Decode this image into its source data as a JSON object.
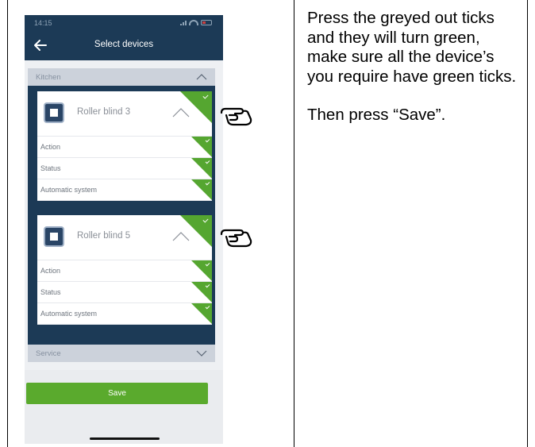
{
  "phone": {
    "status_time": "14:15",
    "nav_title": "Select devices",
    "groups": [
      {
        "label": "Kitchen",
        "expanded": true
      },
      {
        "label": "Service",
        "expanded": false
      }
    ],
    "devices": [
      {
        "name": "Roller blind 3",
        "selected": true,
        "rows": [
          {
            "label": "Action",
            "checked": true
          },
          {
            "label": "Status",
            "checked": true
          },
          {
            "label": "Automatic system",
            "checked": true
          }
        ]
      },
      {
        "name": "Roller blind 5",
        "selected": true,
        "rows": [
          {
            "label": "Action",
            "checked": true
          },
          {
            "label": "Status",
            "checked": true
          },
          {
            "label": "Automatic system",
            "checked": true
          }
        ]
      }
    ],
    "save_label": "Save"
  },
  "instructions": {
    "paragraph1": "Press the greyed out ticks and they will turn green, make sure all the device’s you require have green ticks.",
    "paragraph2": "Then press “Save”."
  },
  "colors": {
    "navbar": "#1c3a56",
    "tick_green": "#55a630",
    "save_green": "#5aaa2d",
    "group_header": "#ccd2db"
  },
  "icons": [
    "back-arrow-icon",
    "chevron-up-icon",
    "chevron-down-icon",
    "roller-blind-icon",
    "pointing-hand-icon",
    "checkmark-icon"
  ]
}
